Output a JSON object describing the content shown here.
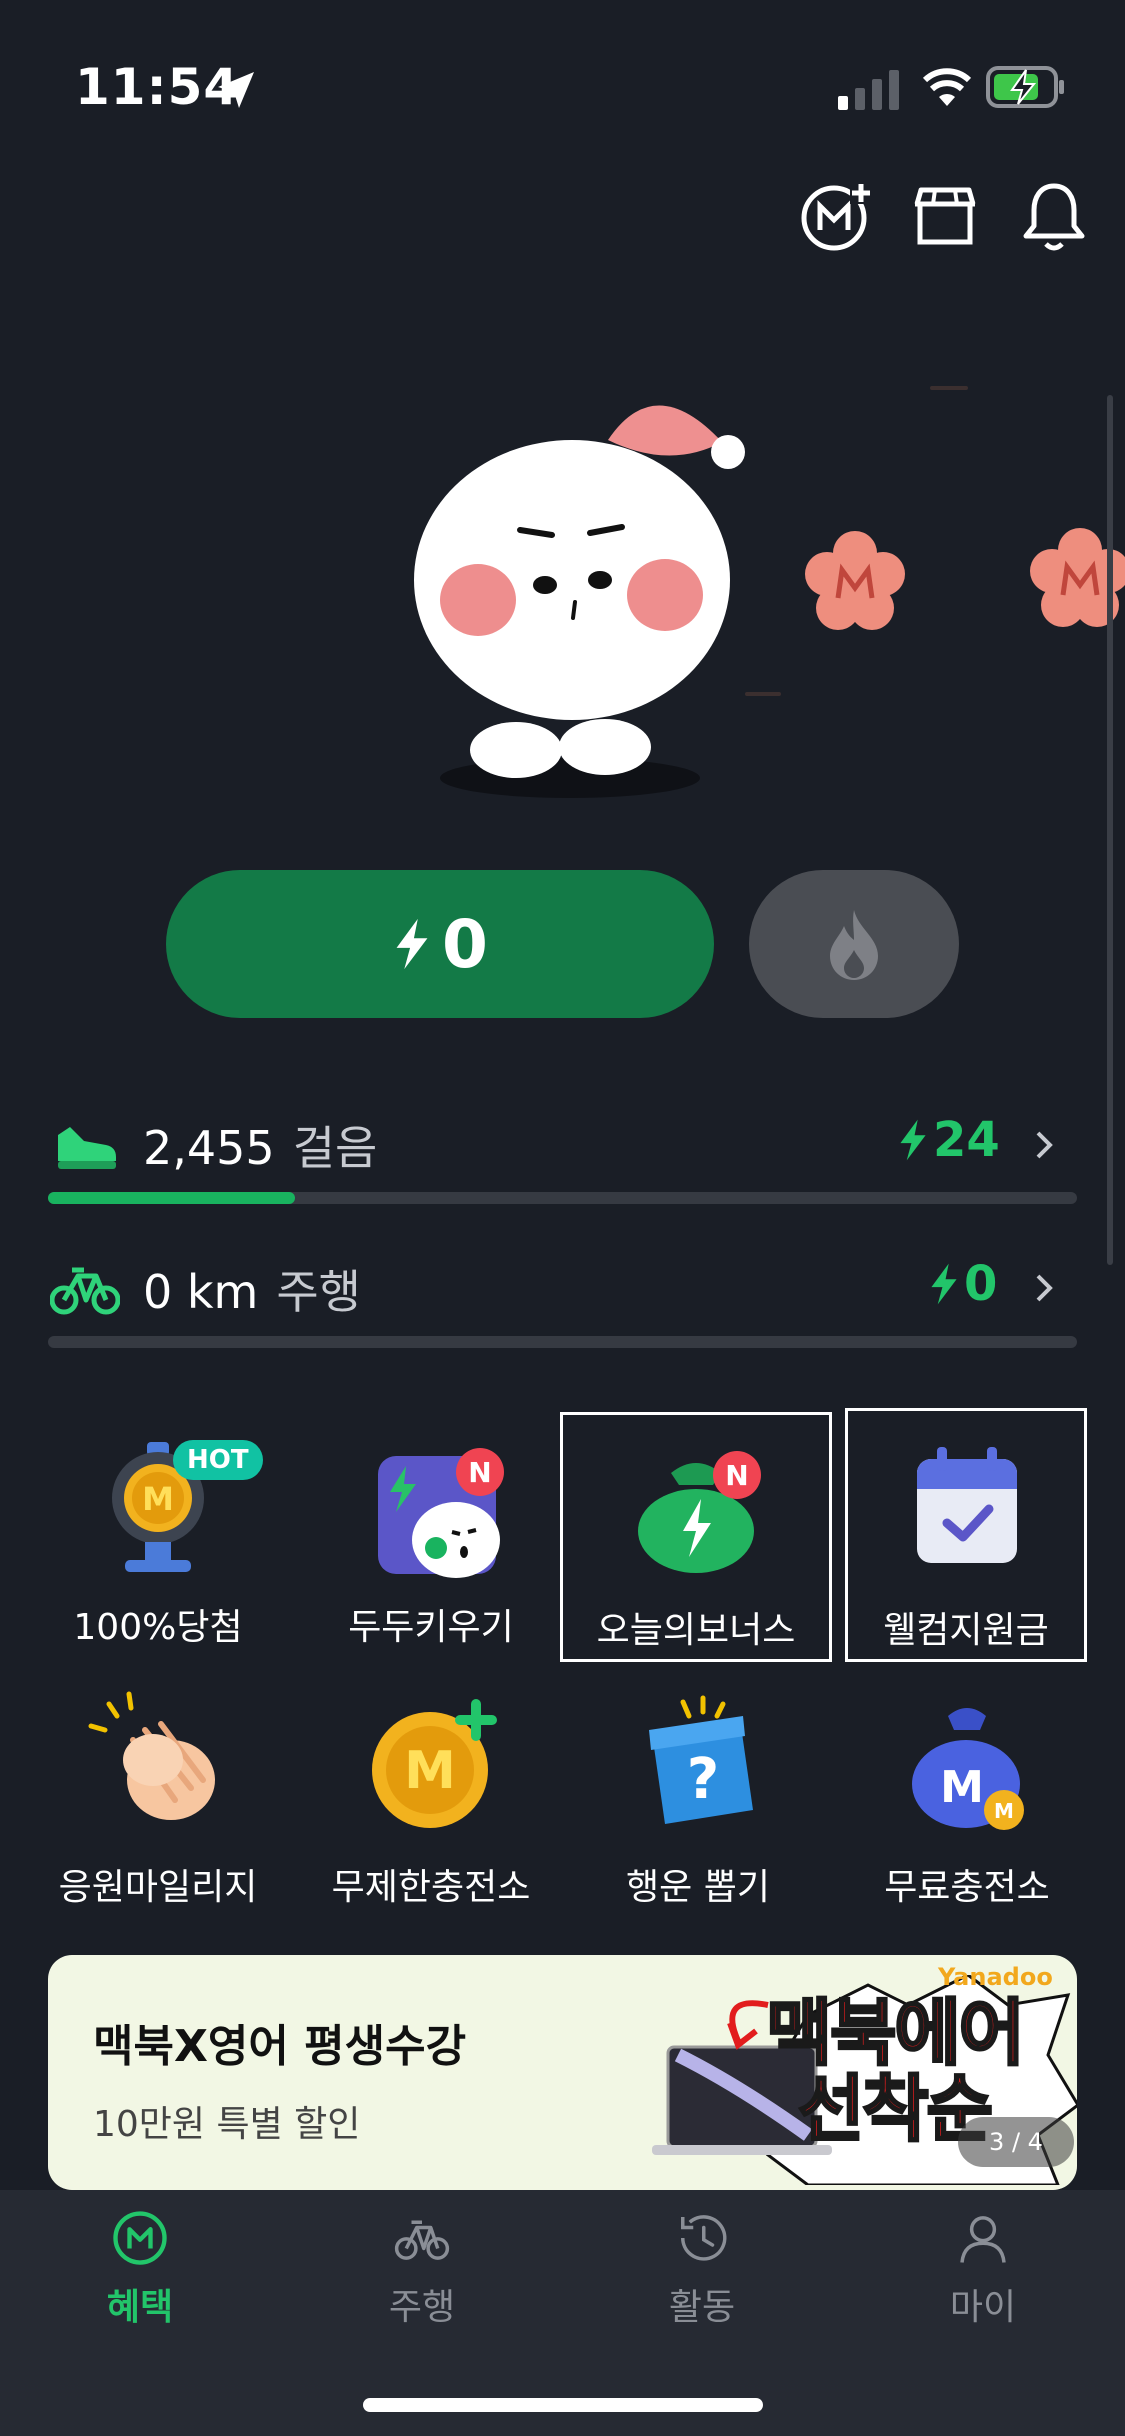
{
  "status_bar": {
    "time": "11:54"
  },
  "points": {
    "value": "0"
  },
  "activities": [
    {
      "value": "2,455",
      "unit": "걸음",
      "reward": "24",
      "progress": 0.24
    },
    {
      "value": "0 km",
      "unit": "주행",
      "reward": "0",
      "progress": 0
    }
  ],
  "menu": [
    {
      "label": "100%당첨",
      "badge": "HOT"
    },
    {
      "label": "두두키우기",
      "badge": "N"
    },
    {
      "label": "오늘의보너스",
      "badge": "N"
    },
    {
      "label": "웰컴지원금"
    },
    {
      "label": "응원마일리지"
    },
    {
      "label": "무제한충전소"
    },
    {
      "label": "행운 뽑기"
    },
    {
      "label": "무료충전소"
    }
  ],
  "banner": {
    "title": "맥북X영어 평생수강",
    "subtitle": "10만원 특별 할인",
    "brand": "Yanadoo",
    "promo_line1": "맥북에어",
    "promo_line2": "선착순",
    "pager": "3 / 4"
  },
  "tabs": [
    {
      "label": "혜택",
      "active": true
    },
    {
      "label": "주행"
    },
    {
      "label": "활동"
    },
    {
      "label": "마이"
    }
  ],
  "colors": {
    "accent": "#22c56a",
    "point_button": "#137a47",
    "background": "#1a1e26"
  }
}
